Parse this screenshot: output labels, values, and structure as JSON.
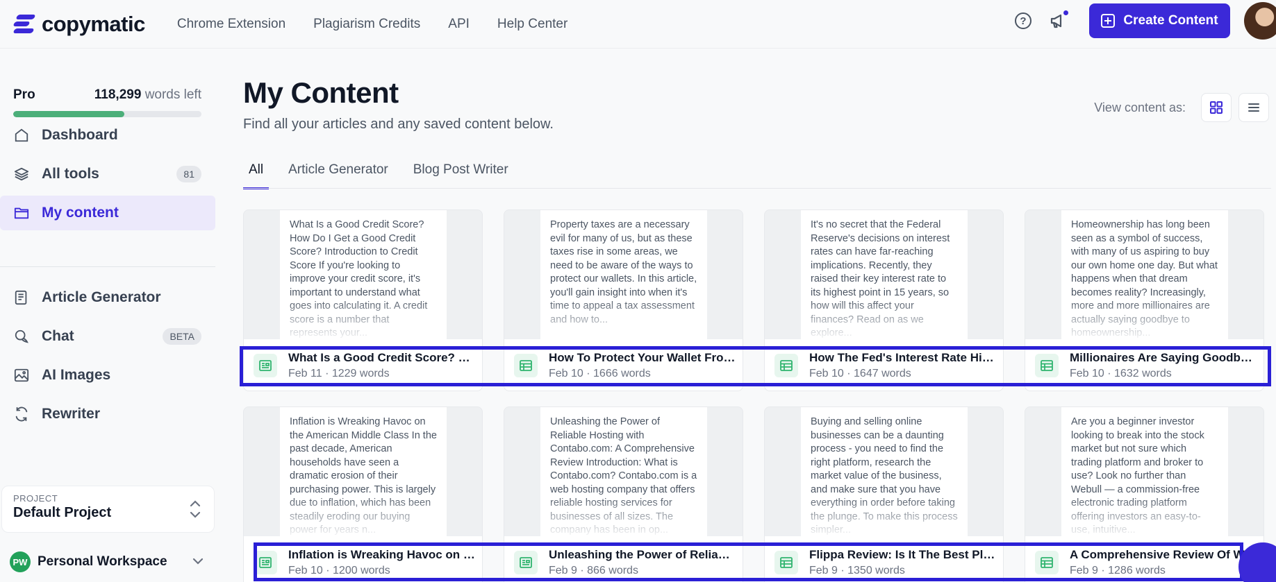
{
  "brand": {
    "name": "copymatic",
    "accent": "#3b29d8"
  },
  "topnav": [
    "Chrome Extension",
    "Plagiarism Credits",
    "API",
    "Help Center"
  ],
  "header": {
    "create_label": "Create Content"
  },
  "plan": {
    "name": "Pro",
    "words": "118,299",
    "words_suffix": "words left",
    "usage_fraction": 0.59
  },
  "sidebar": {
    "primary": [
      {
        "label": "Dashboard",
        "icon": "home-icon",
        "badge": ""
      },
      {
        "label": "All tools",
        "icon": "layers-icon",
        "badge": "81"
      },
      {
        "label": "My content",
        "icon": "folder-icon",
        "badge": ""
      }
    ],
    "secondary": [
      {
        "label": "Article Generator",
        "icon": "article-icon",
        "badge": ""
      },
      {
        "label": "Chat",
        "icon": "chat-icon",
        "badge": "BETA"
      },
      {
        "label": "AI Images",
        "icon": "image-icon",
        "badge": ""
      },
      {
        "label": "Rewriter",
        "icon": "refresh-icon",
        "badge": ""
      }
    ],
    "project_label": "PROJECT",
    "project_name": "Default Project",
    "workspace_initials": "PW",
    "workspace_name": "Personal Workspace"
  },
  "main": {
    "title": "My Content",
    "subtitle": "Find all your articles and any saved content below.",
    "view_label": "View content as:",
    "tabs": [
      "All",
      "Article Generator",
      "Blog Post Writer"
    ]
  },
  "cards": [
    {
      "preview": "What Is a Good Credit Score? How Do I Get a Good Credit Score? Introduction to Credit Score If you're looking to improve your credit score, it's important to understand what goes into calculating it. A credit score is a number that represents your...",
      "title": "What Is a Good Credit Score? How Do I Get a Good Credit Score?",
      "meta": "Feb 11 · 1229 words",
      "icon": "article-doc-icon"
    },
    {
      "preview": "Property taxes are a necessary evil for many of us, but as these taxes rise in some areas, we need to be aware of the ways to protect our wallets. In this article, you'll gain insight into when it's time to appeal a tax assessment and how to...",
      "title": "How To Protect Your Wallet From Rising Property Taxes",
      "meta": "Feb 10 · 1666 words",
      "icon": "table-doc-icon"
    },
    {
      "preview": "It's no secret that the Federal Reserve's decisions on interest rates can have far-reaching implications. Recently, they raised their key interest rate to its highest point in 15 years, so how will this affect your finances? Read on as we explore...",
      "title": "How The Fed's Interest Rate Hike Will Affect Your Finances",
      "meta": "Feb 10 · 1647 words",
      "icon": "table-doc-icon"
    },
    {
      "preview": "Homeownership has long been seen as a symbol of success, with many of us aspiring to buy our own home one day. But what happens when that dream becomes reality? Increasingly, more and more millionaires are actually saying goodbye to homeownership...",
      "title": "Millionaires Are Saying Goodbye To Homeownership",
      "meta": "Feb 10 · 1632 words",
      "icon": "table-doc-icon"
    },
    {
      "preview": "Inflation is Wreaking Havoc on the American Middle Class In the past decade, American households have seen a dramatic erosion of their purchasing power. This is largely due to inflation, which has been steadily eroding our buying power for years n...",
      "title": "Inflation is Wreaking Havoc on the American Middle Class",
      "meta": "Feb 10 · 1200 words",
      "icon": "article-doc-icon"
    },
    {
      "preview": "Unleashing the Power of Reliable Hosting with Contabo.com: A Comprehensive Review Introduction: What is Contabo.com? Contabo.com is a web hosting company that offers reliable hosting services for businesses of all sizes. The company has been in op...",
      "title": "Unleashing the Power of Reliable Hosting with Contabo.com",
      "meta": "Feb 9 · 866 words",
      "icon": "article-doc-icon"
    },
    {
      "preview": "Buying and selling online businesses can be a daunting process - you need to find the right platform, research the market value of the business, and make sure that you have everything in order before taking the plunge. To make this process simpler...",
      "title": "Flippa Review: Is It The Best Place To Buy And Sell Online Businesses?",
      "meta": "Feb 9 · 1350 words",
      "icon": "table-doc-icon"
    },
    {
      "preview": "Are you a beginner investor looking to break into the stock market but not sure which trading platform and broker to use? Look no further than Webull — a commission-free electronic trading platform offering investors an easy-to-use, intuitive...",
      "title": "A Comprehensive Review Of Webull",
      "meta": "Feb 9 · 1286 words",
      "icon": "table-doc-icon"
    }
  ]
}
